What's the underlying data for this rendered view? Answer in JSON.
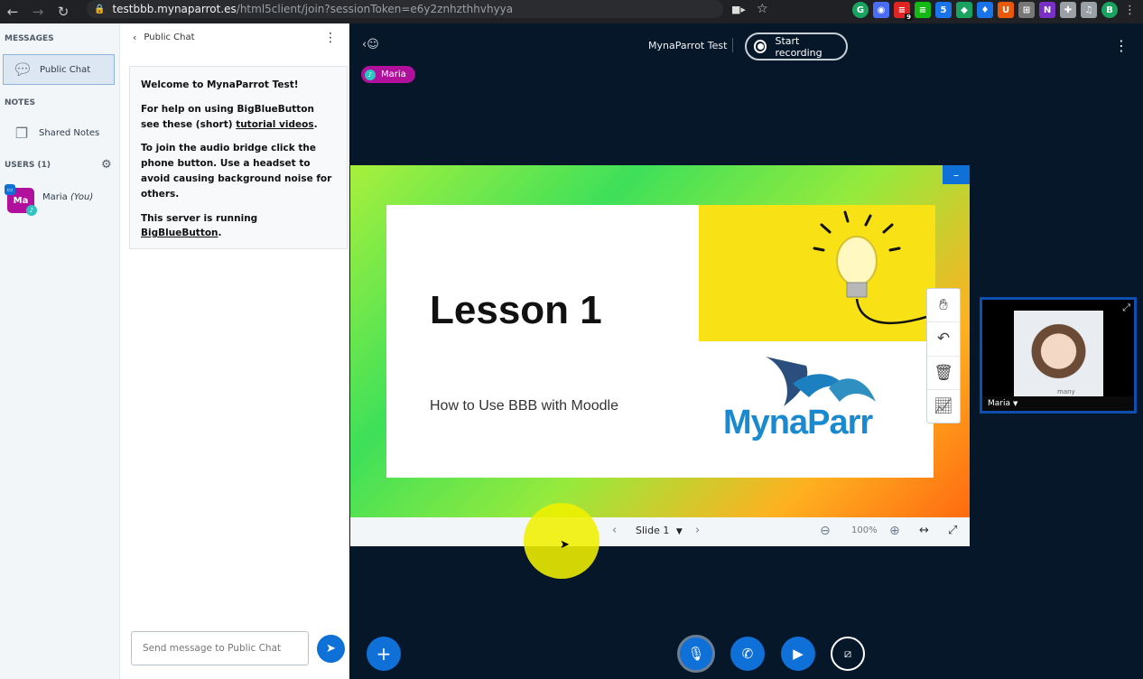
{
  "browser": {
    "url_domain": "testbbb.mynaparrot.es",
    "url_path": "/html5client/join?sessionToken=e6y2znhzthhvhyya",
    "extensions": [
      {
        "glyph": "G",
        "color": "#1aa260"
      },
      {
        "glyph": "◉",
        "color": "#4a6cf7"
      },
      {
        "glyph": "≡",
        "color": "#e02424",
        "badge": "9"
      },
      {
        "glyph": "≡",
        "color": "#14b814"
      },
      {
        "glyph": "5",
        "color": "#1a73e8"
      },
      {
        "glyph": "◆",
        "color": "#1aa260"
      },
      {
        "glyph": "♦",
        "color": "#1a73e8"
      },
      {
        "glyph": "U",
        "color": "#e8590c"
      },
      {
        "glyph": "⊞",
        "color": "#777777"
      },
      {
        "glyph": "N",
        "color": "#7b2fc9"
      },
      {
        "glyph": "✚",
        "color": "#9aa0a6"
      },
      {
        "glyph": "♫",
        "color": "#9aa0a6"
      },
      {
        "glyph": "B",
        "color": "#1aa260"
      }
    ]
  },
  "sidebar": {
    "messages_title": "MESSAGES",
    "public_chat_label": "Public Chat",
    "notes_title": "NOTES",
    "shared_notes_label": "Shared Notes",
    "users_title": "USERS (1)",
    "user_initials": "Ma",
    "user_name": "Maria",
    "user_you": "(You)"
  },
  "chat": {
    "header": "Public Chat",
    "welcome_1a": "Welcome to ",
    "welcome_1b": "MynaParrot Test",
    "welcome_1c": "!",
    "welcome_2a": "For help on using BigBlueButton see these (short) ",
    "welcome_2b": "tutorial videos",
    "welcome_2c": ".",
    "welcome_3": "To join the audio bridge click the phone button. Use a headset to avoid causing background noise for others.",
    "welcome_4a": "This server is running ",
    "welcome_4b": "BigBlueButton",
    "welcome_4c": ".",
    "input_placeholder": "Send message to Public Chat"
  },
  "main": {
    "meeting_title": "MynaParrot Test",
    "record_label": "Start recording",
    "talker_name": "Maria"
  },
  "slide": {
    "title": "Lesson 1",
    "subtitle": "How to Use BBB with Moodle",
    "brand": "MynaParr",
    "nav_label": "Slide 1",
    "zoom": "100%"
  },
  "webcam": {
    "name": "Maria",
    "watermark": "many"
  },
  "colors": {
    "accent": "#0f70d7",
    "user_avatar": "#b0109c",
    "background": "#06172a"
  }
}
